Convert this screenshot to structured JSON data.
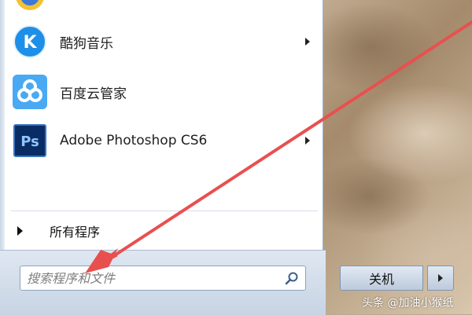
{
  "apps": [
    {
      "label": "酷狗音乐",
      "icon": "kugou-icon",
      "has_submenu": true
    },
    {
      "label": "百度云管家",
      "icon": "baidu-cloud-icon",
      "has_submenu": false
    },
    {
      "label": "Adobe Photoshop CS6",
      "icon": "photoshop-icon",
      "has_submenu": true
    }
  ],
  "photoshop_icon_text": "Ps",
  "kugou_icon_text": "K",
  "all_programs": "所有程序",
  "search": {
    "placeholder": "搜索程序和文件"
  },
  "shutdown": {
    "label": "关机"
  },
  "watermark": "头条 @加油小猴纸",
  "colors": {
    "annotation_arrow": "#e8504f",
    "kugou_blue": "#1e8fe8",
    "photoshop_blue": "#0a2c64"
  }
}
